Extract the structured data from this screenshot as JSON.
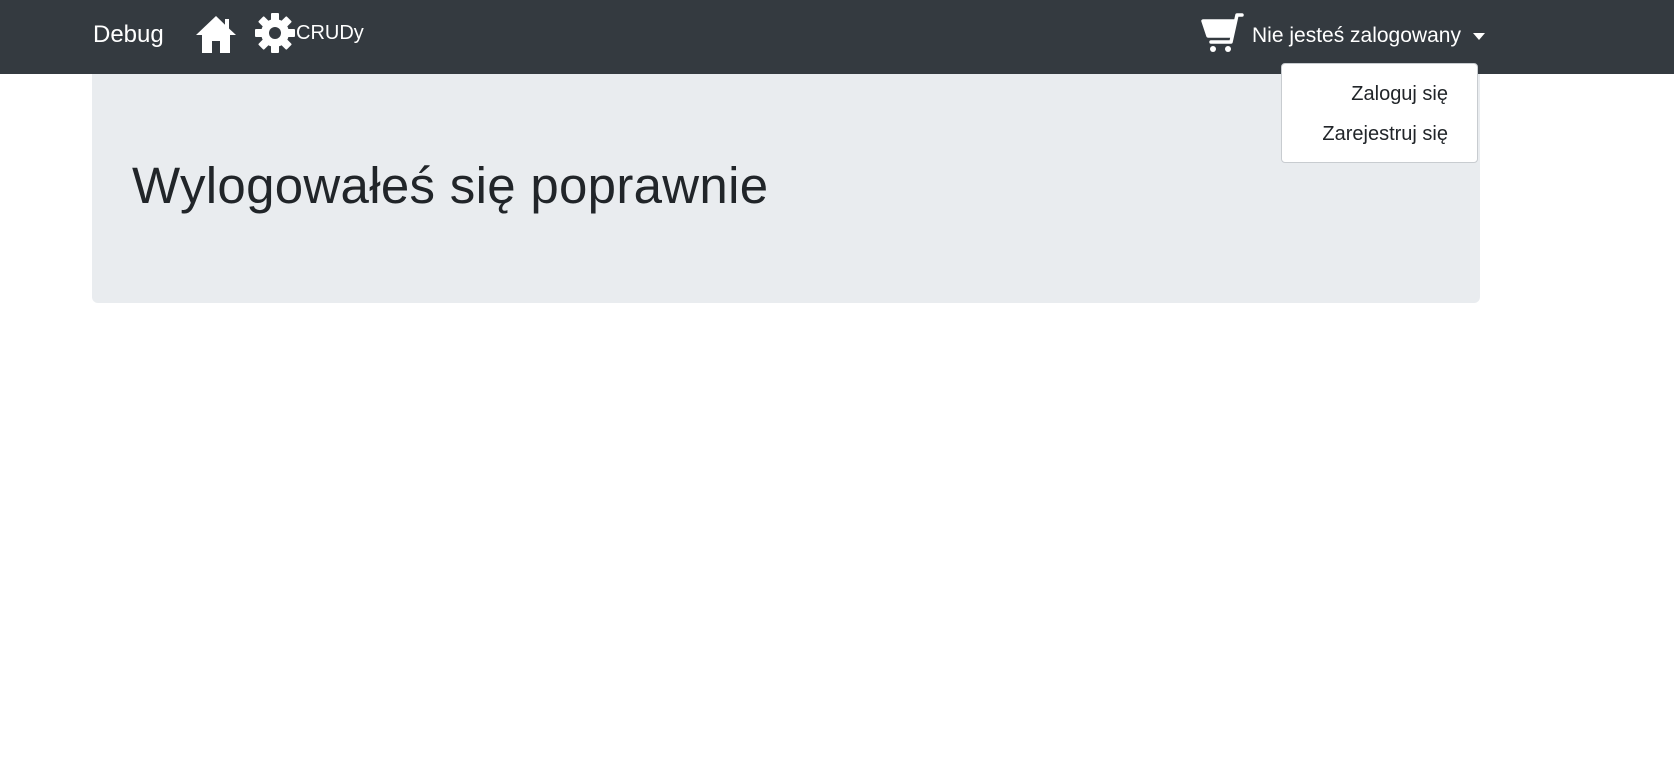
{
  "navbar": {
    "brand": "Debug",
    "home_icon": "home-icon",
    "crud": {
      "icon": "gear-icon",
      "label": "CRUDy"
    },
    "cart_icon": "cart-icon",
    "user_menu": {
      "label": "Nie jesteś zalogowany",
      "items": [
        {
          "label": "Zaloguj się"
        },
        {
          "label": "Zarejestruj się"
        }
      ]
    }
  },
  "main": {
    "heading": "Wylogowałeś się poprawnie"
  },
  "colors": {
    "navbar_bg": "#343a40",
    "jumbotron_bg": "#e9ecef",
    "text": "#212529"
  }
}
